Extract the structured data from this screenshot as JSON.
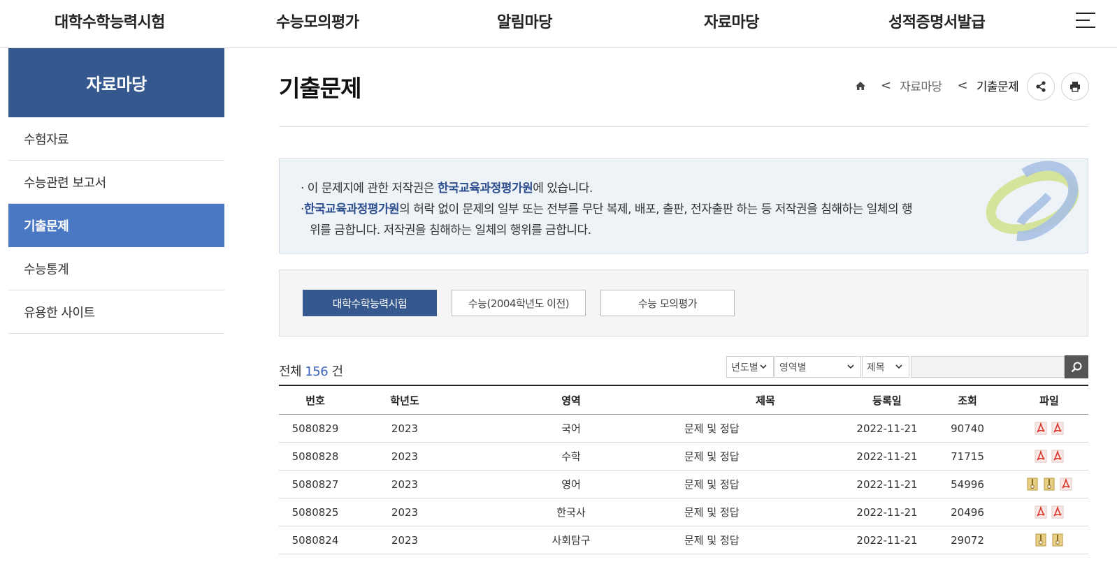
{
  "topnav": {
    "items": [
      "대학수학능력시험",
      "수능모의평가",
      "알림마당",
      "자료마당",
      "성적증명서발급"
    ]
  },
  "sidebar": {
    "heading": "자료마당",
    "items": [
      "수험자료",
      "수능관련 보고서",
      "기출문제",
      "수능통계",
      "유용한 사이트"
    ],
    "active_index": 2
  },
  "page": {
    "title": "기출문제",
    "breadcrumb": [
      "자료마당",
      "기출문제"
    ]
  },
  "notice": {
    "line1_pre": "· 이 문제지에 관한 저작권은 ",
    "line1_org": "한국교육과정평가원",
    "line1_post": "에 있습니다.",
    "line2_bullet": "·",
    "line2_org": "한국교육과정평가원",
    "line2_post": "의 허락 없이 문제의 일부 또는 전부를 무단 복제, 배포, 출판, 전자출판 하는 등 저작권을 침해하는 일체의 행",
    "line3": "위를 금합니다. 저작권을 침해하는 일체의 행위를 금합니다."
  },
  "tabs": [
    "대학수학능력시험",
    "수능(2004학년도 이전)",
    "수능 모의평가"
  ],
  "list": {
    "total_label": "전체",
    "total_count": "156",
    "total_unit": "건"
  },
  "filters": {
    "year": "년도별",
    "area": "영역별",
    "field": "제목"
  },
  "table": {
    "headers": [
      "번호",
      "학년도",
      "영역",
      "제목",
      "등록일",
      "조회",
      "파일"
    ],
    "rows": [
      {
        "no": "5080829",
        "year": "2023",
        "area": "국어",
        "title": "문제 및 정답",
        "date": "2022-11-21",
        "views": "90740",
        "files": [
          "pdf",
          "pdf"
        ]
      },
      {
        "no": "5080828",
        "year": "2023",
        "area": "수학",
        "title": "문제 및 정답",
        "date": "2022-11-21",
        "views": "71715",
        "files": [
          "pdf",
          "pdf"
        ]
      },
      {
        "no": "5080827",
        "year": "2023",
        "area": "영어",
        "title": "문제 및 정답",
        "date": "2022-11-21",
        "views": "54996",
        "files": [
          "zip",
          "zip",
          "pdf"
        ]
      },
      {
        "no": "5080825",
        "year": "2023",
        "area": "한국사",
        "title": "문제 및 정답",
        "date": "2022-11-21",
        "views": "20496",
        "files": [
          "pdf",
          "pdf"
        ]
      },
      {
        "no": "5080824",
        "year": "2023",
        "area": "사회탐구",
        "title": "문제 및 정답",
        "date": "2022-11-21",
        "views": "29072",
        "files": [
          "zip",
          "zip"
        ]
      }
    ]
  },
  "colors": {
    "primary": "#35588f",
    "active_side": "#4a78c2",
    "count": "#3b64b8",
    "pdf": "#d63a2f",
    "zip": "#c9a24a"
  }
}
